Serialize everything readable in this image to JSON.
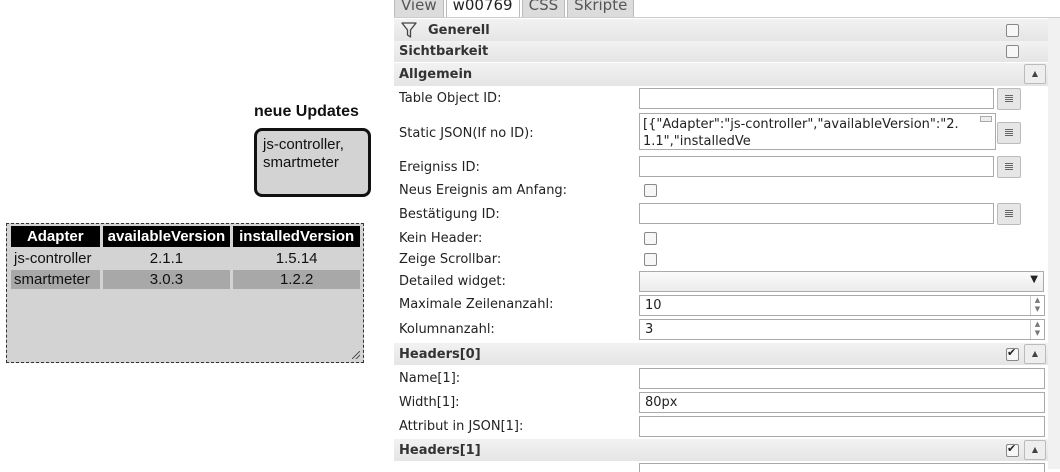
{
  "canvas": {
    "updates_title": "neue Updates",
    "updates_value": "js-controller,\nsmartmeter",
    "table": {
      "headers": [
        "Adapter",
        "availableVersion",
        "installedVersion"
      ],
      "rows": [
        [
          "js-controller",
          "2.1.1",
          "1.5.14"
        ],
        [
          "smartmeter",
          "3.0.3",
          "1.2.2"
        ]
      ]
    }
  },
  "tabs": [
    "View",
    "w00769",
    "CSS",
    "Skripte"
  ],
  "sections": {
    "generell": "Generell",
    "sichtbarkeit": "Sichtbarkeit",
    "allgemein": "Allgemein",
    "headers0": "Headers[0]",
    "headers1": "Headers[1]"
  },
  "fields": {
    "table_object_id": {
      "label": "Table Object ID:",
      "value": ""
    },
    "static_json": {
      "label": "Static JSON(If no ID):",
      "value": "[{\"Adapter\":\"js-controller\",\"availableVersion\":\"2.1.1\",\"installedVe"
    },
    "ereigniss_id": {
      "label": "Ereigniss ID:",
      "value": ""
    },
    "neues_ereignis": {
      "label": "Neus Ereignis am Anfang:"
    },
    "bestaetigung_id": {
      "label": "Bestätigung ID:",
      "value": ""
    },
    "kein_header": {
      "label": "Kein Header:"
    },
    "zeige_scrollbar": {
      "label": "Zeige Scrollbar:"
    },
    "detailed_widget": {
      "label": "Detailed widget:",
      "value": ""
    },
    "max_zeilen": {
      "label": "Maximale Zeilenanzahl:",
      "value": "10"
    },
    "kolumnanzahl": {
      "label": "Kolumnanzahl:",
      "value": "3"
    },
    "name1": {
      "label": "Name[1]:",
      "value": ""
    },
    "width1": {
      "label": "Width[1]:",
      "value": "80px"
    },
    "attribut1": {
      "label": "Attribut in JSON[1]:",
      "value": ""
    }
  },
  "icons": {
    "filter": "filter-icon",
    "browse": "object-browse-icon",
    "collapse": "triangle-up-icon",
    "dropdown": "triangle-down-icon"
  }
}
